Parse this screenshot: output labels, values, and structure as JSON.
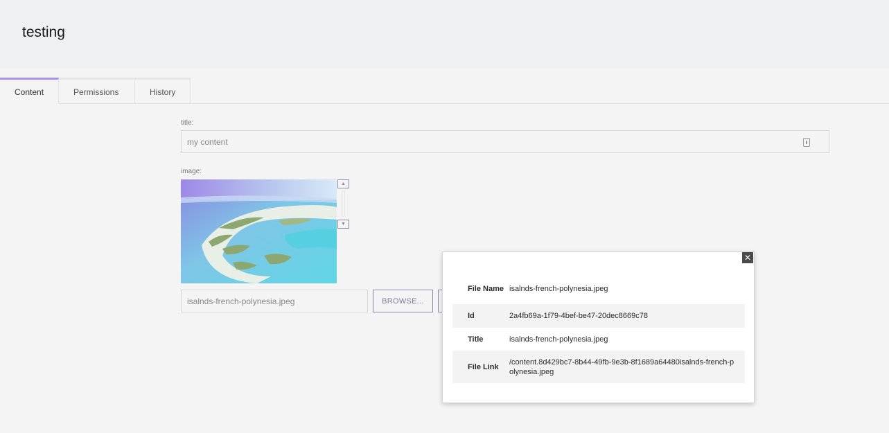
{
  "page": {
    "title": "testing"
  },
  "tabs": [
    {
      "label": "Content",
      "active": true
    },
    {
      "label": "Permissions",
      "active": false
    },
    {
      "label": "History",
      "active": false
    }
  ],
  "form": {
    "title_label": "title:",
    "title_value": "my content",
    "image_label": "image:",
    "file_value": "isalnds-french-polynesia.jpeg",
    "browse_label": "BROWSE..."
  },
  "popup": {
    "close_symbol": "✕",
    "rows": [
      {
        "key": "File Name",
        "value": "isalnds-french-polynesia.jpeg"
      },
      {
        "key": "Id",
        "value": "2a4fb69a-1f79-4bef-be47-20dec8669c78"
      },
      {
        "key": "Title",
        "value": "isalnds-french-polynesia.jpeg"
      },
      {
        "key": "File Link",
        "value": "/content.8d429bc7-8b44-49fb-9e3b-8f1689a64480isalnds-french-polynesia.jpeg"
      }
    ]
  },
  "colors": {
    "accent": "#a594e8",
    "header_bg": "#eef0f1",
    "page_bg": "#f4f4f4"
  }
}
